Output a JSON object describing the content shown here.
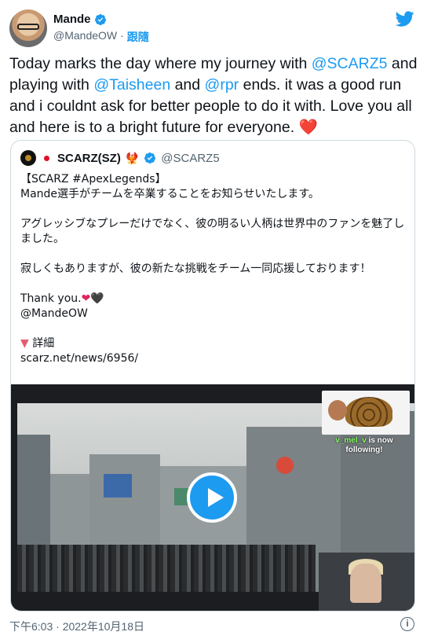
{
  "author": {
    "name": "Mande",
    "handle": "@MandeOW",
    "separator": "·",
    "follow_label": "跟隨"
  },
  "tweet": {
    "text_1": "Today marks the day where my journey with ",
    "mention_1": "@SCARZ5",
    "text_2": " and playing with ",
    "mention_2": "@Taisheen",
    "text_3": " and ",
    "mention_3": "@rpr",
    "text_4": " ends. it was a good run and i couldnt ask for better people to do it with. Love you all and here is to a bright future for everyone. ",
    "emoji": "❤️"
  },
  "quote": {
    "name": "SCARZ(SZ)",
    "name_emoji": "🐦‍🔥",
    "handle": "@SCARZ5",
    "line_1": "【SCARZ #ApexLegends】",
    "line_2": "Mande選手がチームを卒業することをお知らせいたします。",
    "para_2": "アグレッシブなプレーだけでなく、彼の明るい人柄は世界中のファンを魅了しました。",
    "para_3": "寂しくもありますが、彼の新たな挑戦をチーム一同応援しております！",
    "thanks": "Thank you.",
    "thanks_emoji": "❤🖤",
    "mention": "@MandeOW",
    "detail_marker": "▼",
    "detail_label": "詳細",
    "link": "scarz.net/news/6956/"
  },
  "video": {
    "overlay_user": "v_mel_v",
    "overlay_msg": "is now following!"
  },
  "footer": {
    "timestamp": "下午6:03 · 2022年10月18日"
  },
  "colors": {
    "accent": "#1d9bf0",
    "text": "#0f1419",
    "muted": "#536471",
    "heart": "#e0245e"
  }
}
